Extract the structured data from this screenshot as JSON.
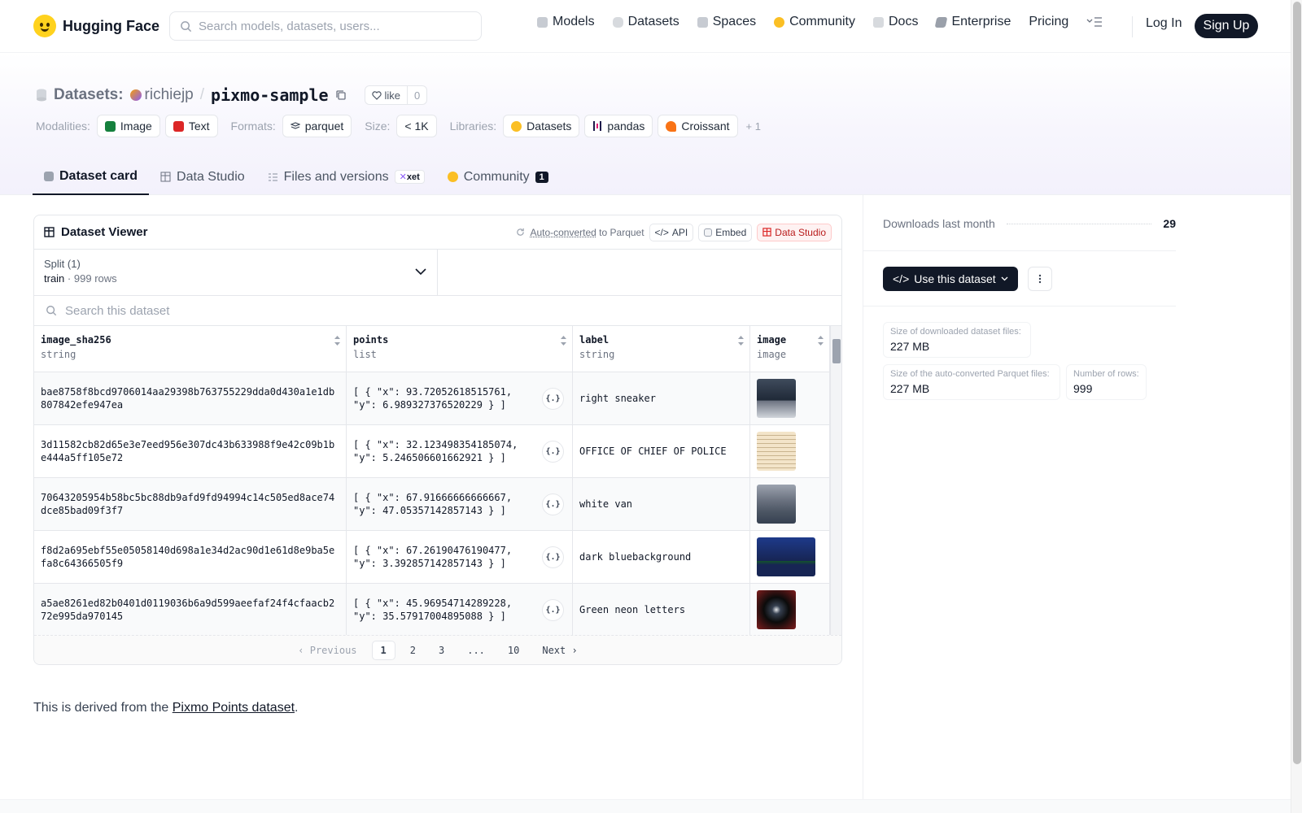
{
  "nav": {
    "brand": "Hugging Face",
    "search_placeholder": "Search models, datasets, users...",
    "links": [
      {
        "label": "Models",
        "icon": "models-icon",
        "color": "#9ca3af"
      },
      {
        "label": "Datasets",
        "icon": "datasets-icon",
        "color": "#d1d5db"
      },
      {
        "label": "Spaces",
        "icon": "spaces-icon",
        "color": "#9ca3af"
      },
      {
        "label": "Community",
        "icon": "community-icon",
        "color": "#fbbf24"
      },
      {
        "label": "Docs",
        "icon": "docs-icon",
        "color": "#d1d5db"
      },
      {
        "label": "Enterprise",
        "icon": "enterprise-icon",
        "color": "#9ca3af"
      },
      {
        "label": "Pricing",
        "icon": "",
        "color": ""
      }
    ],
    "login": "Log In",
    "signup": "Sign Up"
  },
  "repo": {
    "prefix": "Datasets:",
    "owner": "richiejp",
    "slash": "/",
    "name": "pixmo-sample",
    "like_label": "like",
    "like_count": "0"
  },
  "tags": {
    "modalities_label": "Modalities:",
    "modalities": [
      {
        "label": "Image",
        "color": "#15803d"
      },
      {
        "label": "Text",
        "color": "#dc2626"
      }
    ],
    "formats_label": "Formats:",
    "formats": [
      {
        "label": "parquet"
      }
    ],
    "size_label": "Size:",
    "size": "< 1K",
    "libraries_label": "Libraries:",
    "libraries": [
      {
        "label": "Datasets",
        "color": "#fbbf24"
      },
      {
        "label": "pandas",
        "color": "#1e1b4b"
      },
      {
        "label": "Croissant",
        "color": "#f97316"
      }
    ],
    "more": "+ 1"
  },
  "tabs": [
    {
      "label": "Dataset card",
      "active": true
    },
    {
      "label": "Data Studio",
      "active": false
    },
    {
      "label": "Files and versions",
      "badge": "xet",
      "active": false
    },
    {
      "label": "Community",
      "count": "1",
      "active": false
    }
  ],
  "viewer": {
    "title": "Dataset Viewer",
    "auto_converted": "Auto-converted",
    "to_parquet": "to Parquet",
    "api": "API",
    "embed": "Embed",
    "data_studio": "Data Studio",
    "split_label": "Split (1)",
    "split_name": "train",
    "split_sep": "·",
    "split_rows": "999 rows",
    "search_placeholder": "Search this dataset",
    "columns": [
      {
        "name": "image_sha256",
        "type": "string"
      },
      {
        "name": "points",
        "type": "list"
      },
      {
        "name": "label",
        "type": "string"
      },
      {
        "name": "image",
        "type": "image"
      }
    ],
    "rows": [
      {
        "sha": "bae8758f8bcd9706014aa29398b763755229dda0d430a1e1db807842efe947ea",
        "points": "[ { \"x\": 93.72052618515761, \"y\": 6.989327376520229 } ]",
        "label": "right sneaker",
        "thumb": "sneaker"
      },
      {
        "sha": "3d11582cb82d65e3e7eed956e307dc43b633988f9e42c09b1be444a5ff105e72",
        "points": "[ { \"x\": 32.123498354185074, \"y\": 5.246506601662921 } ]",
        "label": "OFFICE OF CHIEF OF POLICE",
        "thumb": "document"
      },
      {
        "sha": "70643205954b58bc5bc88db9afd9fd94994c14c505ed8ace74dce85bad09f3f7",
        "points": "[ { \"x\": 67.91666666666667, \"y\": 47.05357142857143 } ]",
        "label": "white van",
        "thumb": "street"
      },
      {
        "sha": "f8d2a695ebf55e05058140d698a1e34d2ac90d1e61d8e9ba5efa8c64366505f9",
        "points": "[ { \"x\": 67.26190476190477, \"y\": 3.392857142857143 } ]",
        "label": "dark bluebackground",
        "thumb": "screen"
      },
      {
        "sha": "a5ae8261ed82b0401d0119036b6a9d599aeefaf24f4cfaacb272e995da970145",
        "points": "[ { \"x\": 45.96954714289228, \"y\": 35.57917004895088 } ]",
        "label": "Green neon letters",
        "thumb": "neon"
      }
    ],
    "pager": {
      "prev": "Previous",
      "pages": [
        "1",
        "2",
        "3",
        "...",
        "10"
      ],
      "current": "1",
      "next": "Next"
    }
  },
  "card": {
    "text_before": "This is derived from the ",
    "link": "Pixmo Points dataset",
    "text_after": "."
  },
  "sidebar": {
    "downloads_label": "Downloads last month",
    "downloads": "29",
    "use_button": "Use this dataset",
    "stats": [
      {
        "label": "Size of downloaded dataset files:",
        "value": "227 MB"
      },
      {
        "label": "Size of the auto-converted Parquet files:",
        "value": "227 MB"
      },
      {
        "label": "Number of rows:",
        "value": "999"
      }
    ]
  }
}
